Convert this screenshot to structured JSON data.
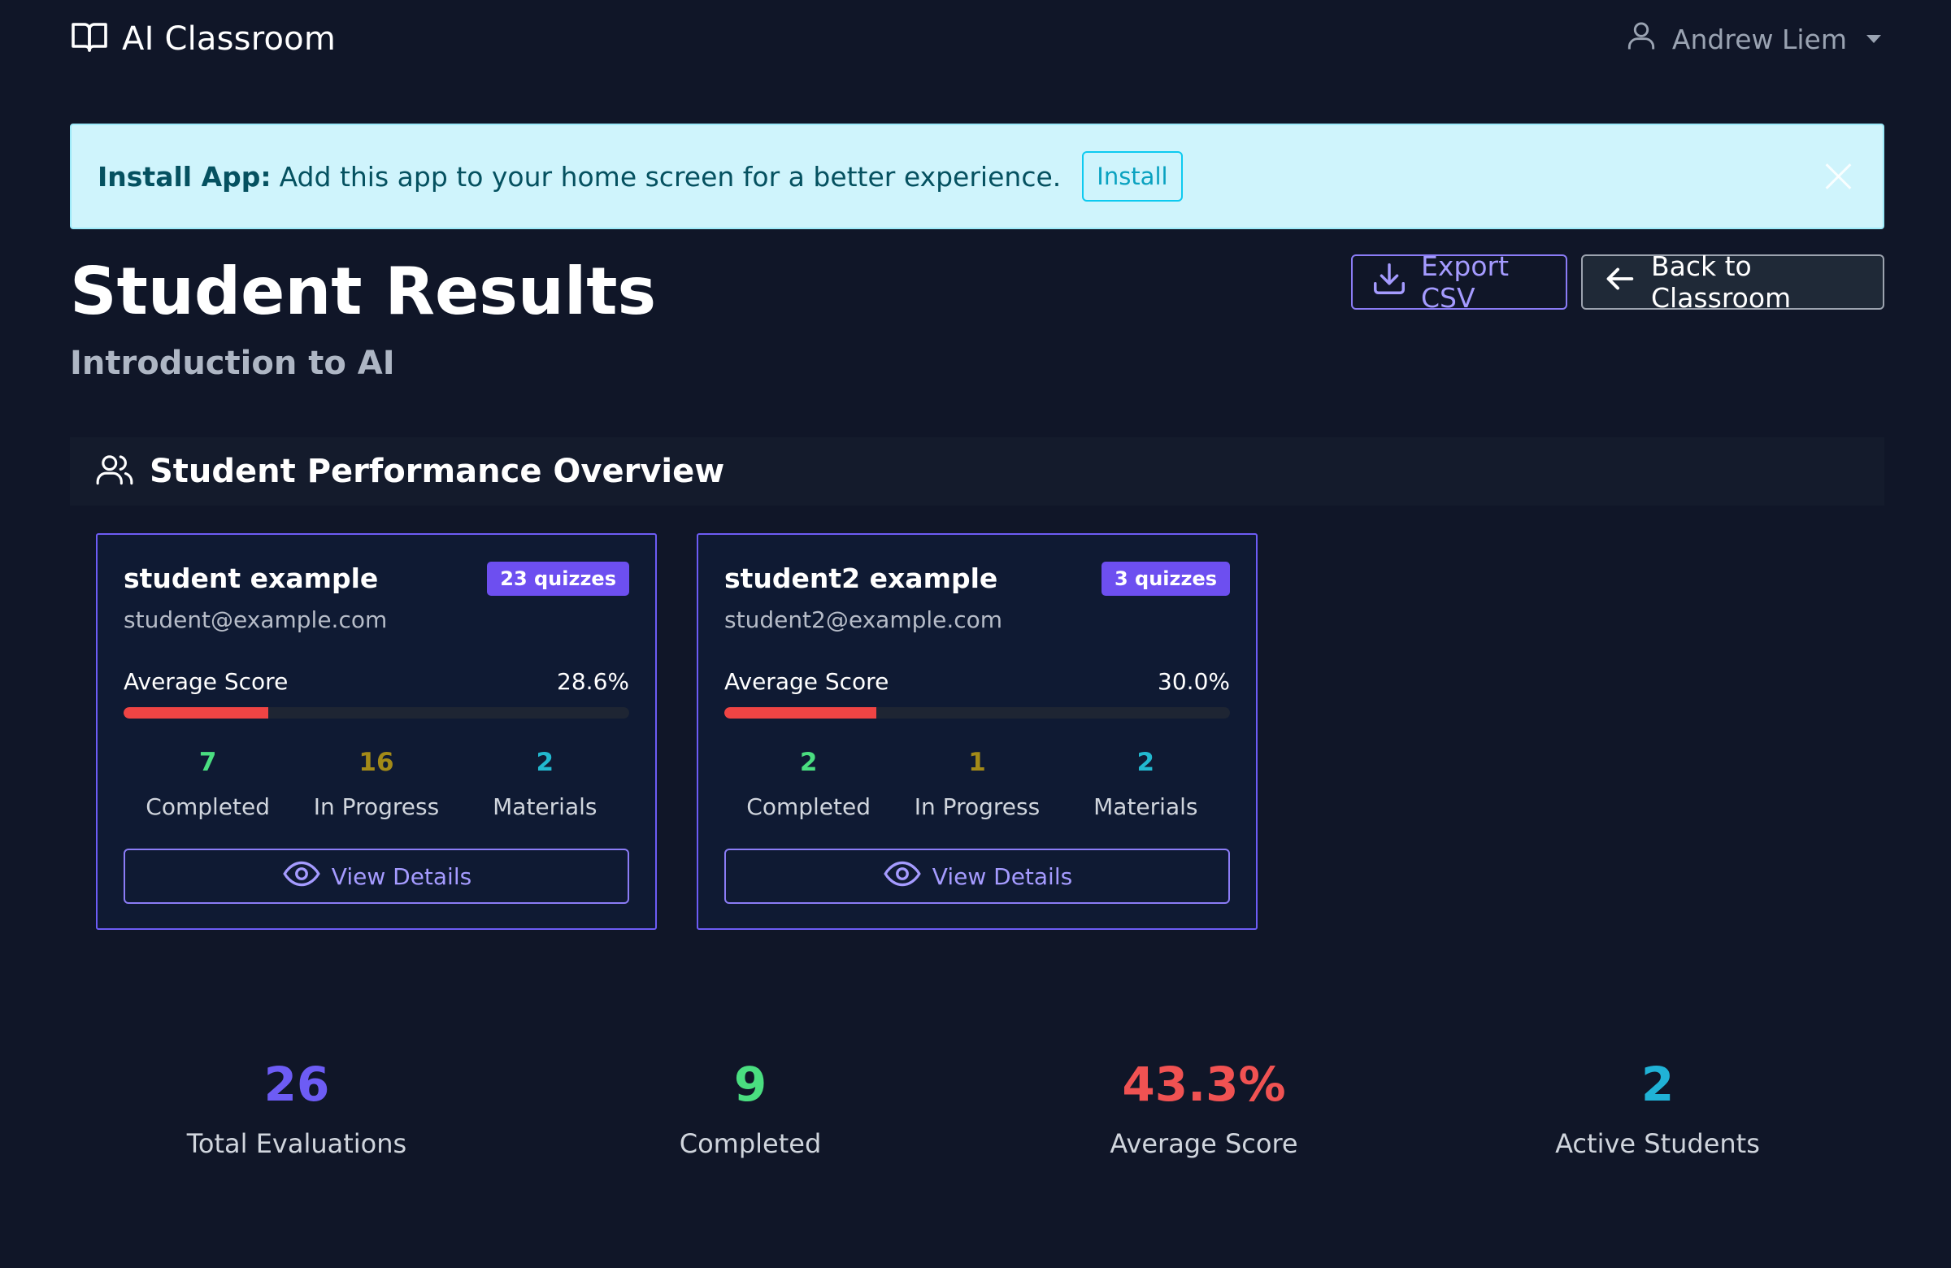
{
  "navbar": {
    "brand_icon": "book-icon",
    "app_title": "AI Classroom",
    "user_icon": "user-icon",
    "user_name": "Andrew Liem"
  },
  "alert": {
    "title": "Install App:",
    "message": "Add this app to your home screen for a better experience.",
    "button_label": "Install",
    "close_icon": "close-icon"
  },
  "header": {
    "title": "Student Results",
    "subtitle": "Introduction to AI",
    "export_label": "Export CSV",
    "export_icon": "download-icon",
    "back_label": "Back to Classroom",
    "back_icon": "arrow-left-icon"
  },
  "section": {
    "icon": "users-icon",
    "title": "Student Performance Overview"
  },
  "students": [
    {
      "name": "student example",
      "badge": "23 quizzes",
      "email": "student@example.com",
      "score_label": "Average Score",
      "score_text": "28.6%",
      "score_fraction": 0.286,
      "completed": "7",
      "completed_label": "Completed",
      "in_progress": "16",
      "in_progress_label": "In Progress",
      "materials": "2",
      "materials_label": "Materials",
      "view_label": "View Details",
      "view_icon": "eye-icon"
    },
    {
      "name": "student2 example",
      "badge": "3 quizzes",
      "email": "student2@example.com",
      "score_label": "Average Score",
      "score_text": "30.0%",
      "score_fraction": 0.3,
      "completed": "2",
      "completed_label": "Completed",
      "in_progress": "1",
      "in_progress_label": "In Progress",
      "materials": "2",
      "materials_label": "Materials",
      "view_label": "View Details",
      "view_icon": "eye-icon"
    }
  ],
  "summary": [
    {
      "value": "26",
      "label": "Total Evaluations",
      "color": "#6d5cf5"
    },
    {
      "value": "9",
      "label": "Completed",
      "color": "#4ade80"
    },
    {
      "value": "43.3%",
      "label": "Average Score",
      "color": "#f05252"
    },
    {
      "value": "2",
      "label": "Active Students",
      "color": "#20b2d6"
    }
  ],
  "colors": {
    "background": "#101628",
    "accent": "#6d5cf5",
    "progress_fill": "#ef4444",
    "alert_bg": "#cff4fc"
  }
}
